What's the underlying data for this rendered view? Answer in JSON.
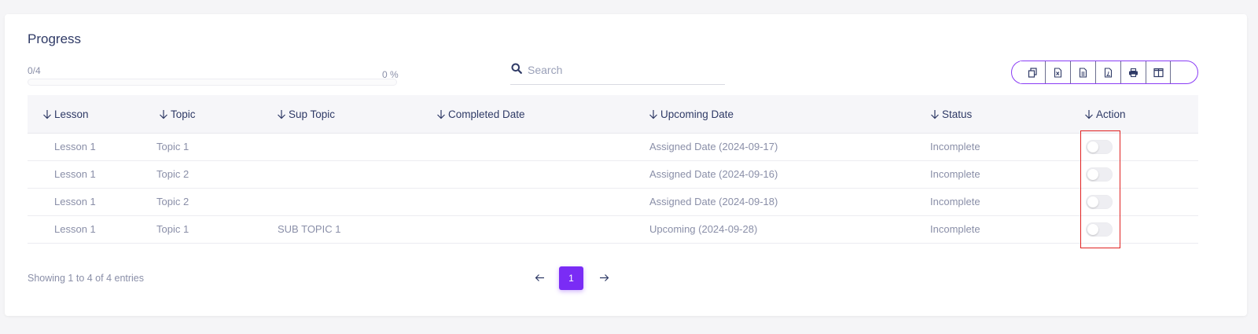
{
  "card": {
    "title": "Progress"
  },
  "progress": {
    "count_text": "0/4",
    "percent_text": "0 %",
    "fraction": 0
  },
  "search": {
    "placeholder": "Search",
    "value": ""
  },
  "toolbar": {
    "buttons": [
      {
        "icon": "copy-icon"
      },
      {
        "icon": "excel-icon"
      },
      {
        "icon": "csv-icon"
      },
      {
        "icon": "pdf-icon"
      },
      {
        "icon": "print-icon"
      },
      {
        "icon": "columns-icon"
      }
    ]
  },
  "table": {
    "columns": [
      "Lesson",
      "Topic",
      "Sup Topic",
      "Completed Date",
      "Upcoming Date",
      "Status",
      "Action"
    ],
    "rows": [
      {
        "lesson": "Lesson 1",
        "topic": "Topic 1",
        "sup_topic": "",
        "completed_date": "",
        "upcoming_date": "Assigned Date (2024-09-17)",
        "status": "Incomplete",
        "action_on": false
      },
      {
        "lesson": "Lesson 1",
        "topic": "Topic 2",
        "sup_topic": "",
        "completed_date": "",
        "upcoming_date": "Assigned Date (2024-09-16)",
        "status": "Incomplete",
        "action_on": false
      },
      {
        "lesson": "Lesson 1",
        "topic": "Topic 2",
        "sup_topic": "",
        "completed_date": "",
        "upcoming_date": "Assigned Date (2024-09-18)",
        "status": "Incomplete",
        "action_on": false
      },
      {
        "lesson": "Lesson 1",
        "topic": "Topic 1",
        "sup_topic": "SUB TOPIC 1",
        "completed_date": "",
        "upcoming_date": "Upcoming (2024-09-28)",
        "status": "Incomplete",
        "action_on": false
      }
    ]
  },
  "footer": {
    "entries_info": "Showing 1 to 4 of 4 entries"
  },
  "pagination": {
    "current_page": "1"
  },
  "colors": {
    "accent": "#7a2cf5",
    "highlight": "#e02020",
    "text": "#2f3a66",
    "muted": "#8a8fa8"
  }
}
